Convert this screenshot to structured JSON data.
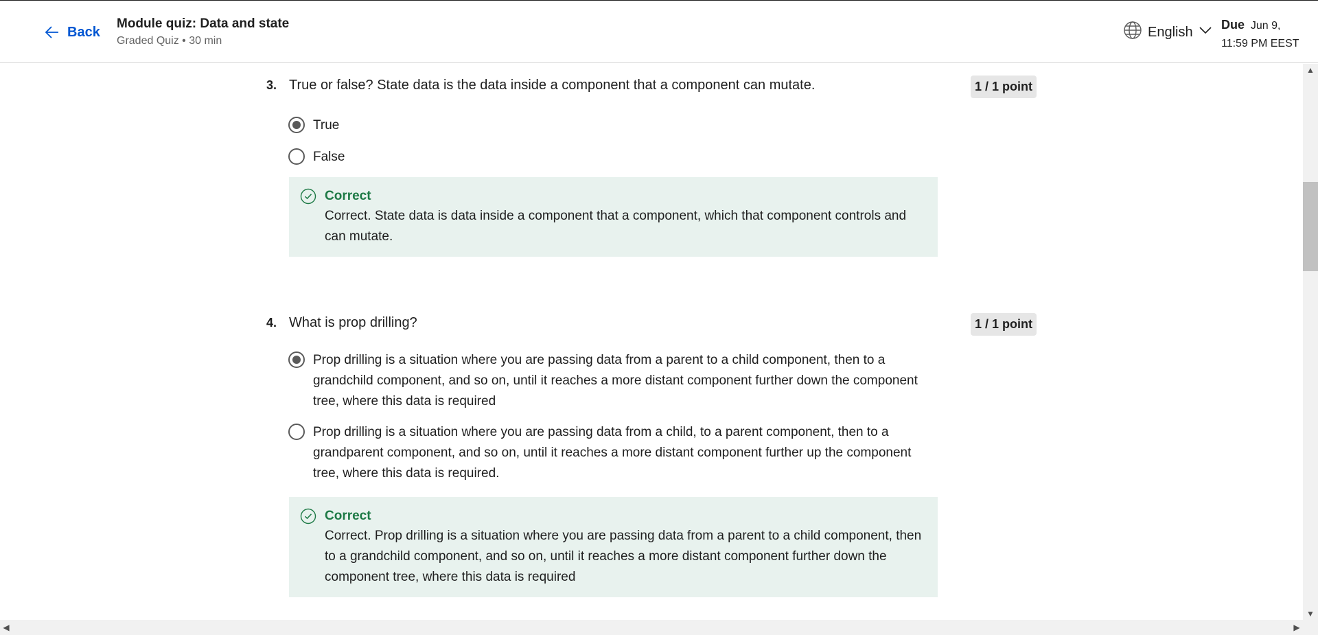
{
  "header": {
    "back_label": "Back",
    "title": "Module quiz: Data and state",
    "subtitle": "Graded Quiz • 30 min",
    "language": "English",
    "due_label": "Due",
    "due_value": "Jun 9, 11:59 PM EEST"
  },
  "questions": [
    {
      "number": "3.",
      "text": "True or false? State data is the data inside a component that a component can mutate.",
      "points": "1 / 1 point",
      "options": [
        {
          "label": "True",
          "selected": true
        },
        {
          "label": "False",
          "selected": false
        }
      ],
      "feedback": {
        "title": "Correct",
        "text": "Correct. State data is data inside a component that a component, which that component controls and can mutate."
      }
    },
    {
      "number": "4.",
      "text": "What is prop drilling?",
      "points": "1 / 1 point",
      "options": [
        {
          "label": "Prop drilling is a situation where you are passing data from a parent to a child component, then to a grandchild component, and so on, until it reaches a more distant component further down the component tree, where this data is required",
          "selected": true
        },
        {
          "label": "Prop drilling is a situation where you are passing data from a child, to a parent component, then to a grandparent component, and so on, until it reaches a more distant component further up the component tree, where this data is required.",
          "selected": false
        }
      ],
      "feedback": {
        "title": "Correct",
        "text": "Correct. Prop drilling is a situation where you are passing data from a parent to a child component, then to a grandchild component, and so on, until it reaches a more distant component further down the component tree, where this data is required"
      }
    }
  ],
  "colors": {
    "accent": "#0056d2",
    "correct": "#1e7a46",
    "feedback_bg": "#e8f2ee"
  },
  "icons": {
    "back": "arrow-left-icon",
    "language": "globe-icon",
    "dropdown": "chevron-down-icon",
    "correct": "check-circle-icon"
  }
}
